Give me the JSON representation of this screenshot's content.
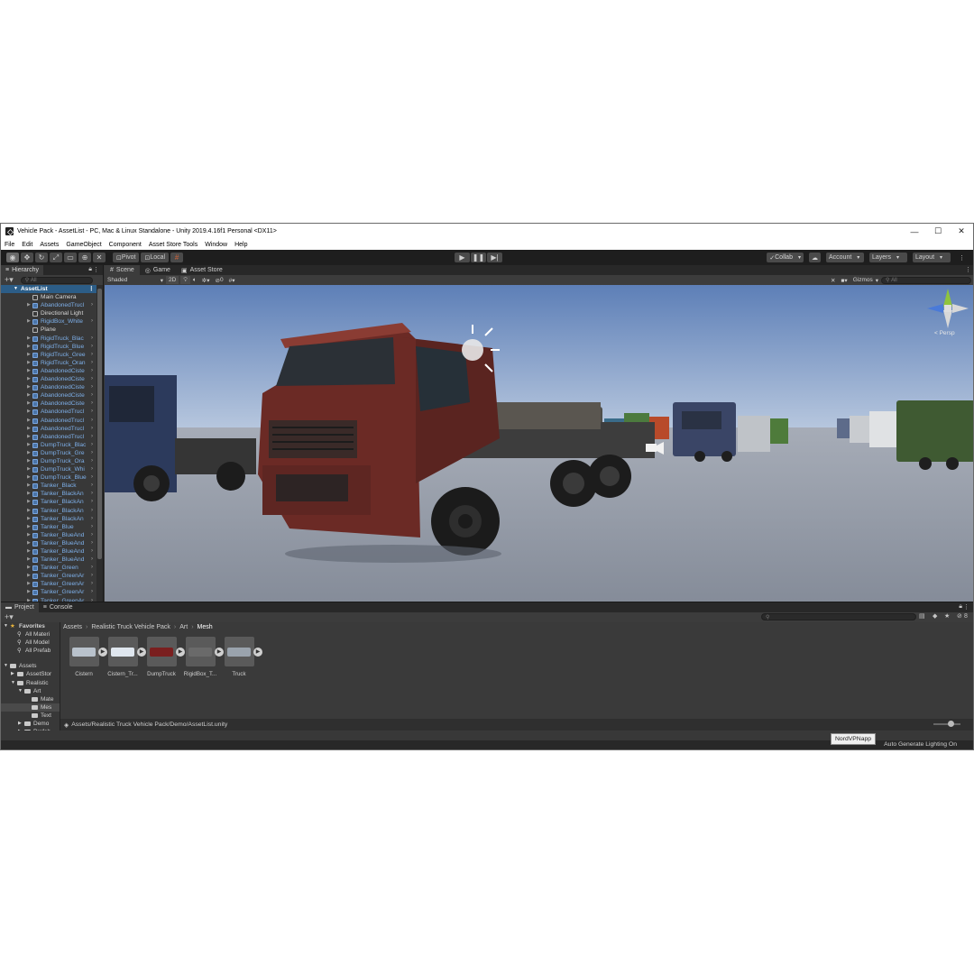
{
  "window": {
    "title": "Vehicle Pack - AssetList - PC, Mac & Linux Standalone - Unity 2019.4.16f1 Personal <DX11>",
    "minimize": "—",
    "maximize": "☐",
    "close": "✕"
  },
  "menu": [
    "File",
    "Edit",
    "Assets",
    "GameObject",
    "Component",
    "Asset Store Tools",
    "Window",
    "Help"
  ],
  "toolbar": {
    "pivot": "Pivot",
    "local": "Local",
    "collab": "Collab",
    "account": "Account",
    "layers": "Layers",
    "layout": "Layout"
  },
  "hierarchy": {
    "tab": "Hierarchy",
    "search_placeholder": "All",
    "scene": "AssetList",
    "items": [
      {
        "name": "Main Camera",
        "kind": "plain",
        "fold": false
      },
      {
        "name": "AbandonedTrucl",
        "kind": "prefab",
        "fold": true
      },
      {
        "name": "Directional Light",
        "kind": "plain",
        "fold": false
      },
      {
        "name": "RigidBox_White",
        "kind": "prefab",
        "fold": true
      },
      {
        "name": "Plane",
        "kind": "plain",
        "fold": false
      },
      {
        "name": "RigidTruck_Blac",
        "kind": "prefab",
        "fold": true
      },
      {
        "name": "RigidTruck_Blue",
        "kind": "prefab",
        "fold": true
      },
      {
        "name": "RigidTruck_Gree",
        "kind": "prefab",
        "fold": true
      },
      {
        "name": "RigidTruck_Oran",
        "kind": "prefab",
        "fold": true
      },
      {
        "name": "AbandonedCiste",
        "kind": "prefab",
        "fold": true
      },
      {
        "name": "AbandonedCiste",
        "kind": "prefab",
        "fold": true
      },
      {
        "name": "AbandonedCiste",
        "kind": "prefab",
        "fold": true
      },
      {
        "name": "AbandonedCiste",
        "kind": "prefab",
        "fold": true
      },
      {
        "name": "AbandonedCiste",
        "kind": "prefab",
        "fold": true
      },
      {
        "name": "AbandonedTrucl",
        "kind": "prefab",
        "fold": true
      },
      {
        "name": "AbandonedTrucl",
        "kind": "prefab",
        "fold": true
      },
      {
        "name": "AbandonedTrucl",
        "kind": "prefab",
        "fold": true
      },
      {
        "name": "AbandonedTrucl",
        "kind": "prefab",
        "fold": true
      },
      {
        "name": "DumpTruck_Blac",
        "kind": "prefab",
        "fold": true
      },
      {
        "name": "DumpTruck_Gre",
        "kind": "prefab",
        "fold": true
      },
      {
        "name": "DumpTruck_Ora",
        "kind": "prefab",
        "fold": true
      },
      {
        "name": "DumpTruck_Whi",
        "kind": "prefab",
        "fold": true
      },
      {
        "name": "DumpTruck_Blue",
        "kind": "prefab",
        "fold": true
      },
      {
        "name": "Tanker_Black",
        "kind": "prefab",
        "fold": true
      },
      {
        "name": "Tanker_BlackAn",
        "kind": "prefab",
        "fold": true
      },
      {
        "name": "Tanker_BlackAn",
        "kind": "prefab",
        "fold": true
      },
      {
        "name": "Tanker_BlackAn",
        "kind": "prefab",
        "fold": true
      },
      {
        "name": "Tanker_BlackAn",
        "kind": "prefab",
        "fold": true
      },
      {
        "name": "Tanker_Blue",
        "kind": "prefab",
        "fold": true
      },
      {
        "name": "Tanker_BlueAnd",
        "kind": "prefab",
        "fold": true
      },
      {
        "name": "Tanker_BlueAnd",
        "kind": "prefab",
        "fold": true
      },
      {
        "name": "Tanker_BlueAnd",
        "kind": "prefab",
        "fold": true
      },
      {
        "name": "Tanker_BlueAnd",
        "kind": "prefab",
        "fold": true
      },
      {
        "name": "Tanker_Green",
        "kind": "prefab",
        "fold": true
      },
      {
        "name": "Tanker_GreenAr",
        "kind": "prefab",
        "fold": true
      },
      {
        "name": "Tanker_GreenAr",
        "kind": "prefab",
        "fold": true
      },
      {
        "name": "Tanker_GreenAr",
        "kind": "prefab",
        "fold": true
      },
      {
        "name": "Tanker_GreenAr",
        "kind": "prefab",
        "fold": true
      }
    ]
  },
  "scene_view": {
    "tabs": [
      "Scene",
      "Game",
      "Asset Store"
    ],
    "shading": "Shaded",
    "mode_2d": "2D",
    "hidden_count": "0",
    "gizmos": "Gizmos",
    "search_placeholder": "All",
    "persp": "< Persp",
    "sky_top": "#5d7fb7",
    "sky_bottom": "#b7c7de",
    "ground": "#8e95a2"
  },
  "project": {
    "tabs": [
      "Project",
      "Console"
    ],
    "badge": "8",
    "favorites": {
      "label": "Favorites",
      "items": [
        "All Materi",
        "All Model",
        "All Prefab"
      ]
    },
    "tree": [
      {
        "label": "Assets",
        "level": 0
      },
      {
        "label": "AssetStor",
        "level": 1
      },
      {
        "label": "Realistic",
        "level": 1
      },
      {
        "label": "Art",
        "level": 2
      },
      {
        "label": "Mate",
        "level": 3
      },
      {
        "label": "Mes",
        "level": 3
      },
      {
        "label": "Text",
        "level": 3
      },
      {
        "label": "Demo",
        "level": 2
      },
      {
        "label": "Prefab",
        "level": 2
      }
    ],
    "breadcrumb": [
      "Assets",
      "Realistic Truck Vehicle Pack",
      "Art",
      "Mesh"
    ],
    "assets": [
      {
        "label": "Cistern",
        "tone": "#b9c2cc"
      },
      {
        "label": "Cistern_Tr...",
        "tone": "#dfe6ee"
      },
      {
        "label": "DumpTruck",
        "tone": "#7a1f1f"
      },
      {
        "label": "RigidBox_T...",
        "tone": "#6a6a6a"
      },
      {
        "label": "Truck",
        "tone": "#9aa3ad"
      }
    ],
    "path": "Assets/Realistic Truck Vehicle Pack/Demo/AssetList.unity"
  },
  "status": {
    "message": "Auto Generate Lighting On",
    "tooltip": "NordVPNapp"
  }
}
